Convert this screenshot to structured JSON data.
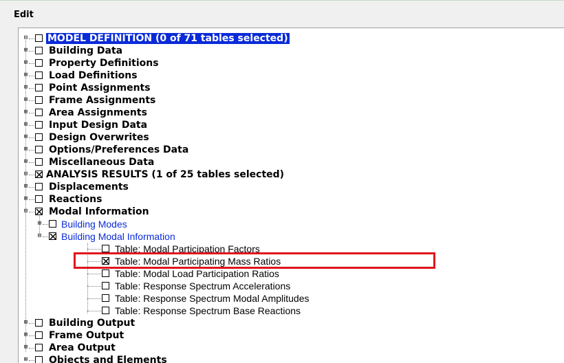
{
  "menu": {
    "edit": "Edit"
  },
  "tree": {
    "model_definition": {
      "label": "MODEL DEFINITION  (0 of 71 tables selected)",
      "children": [
        "Building Data",
        "Property Definitions",
        "Load Definitions",
        "Point Assignments",
        "Frame Assignments",
        "Area Assignments",
        "Input Design Data",
        "Design Overwrites",
        "Options/Preferences Data",
        "Miscellaneous Data"
      ]
    },
    "analysis_results": {
      "label": "ANALYSIS RESULTS  (1 of 25 tables selected)",
      "displacements": "Displacements",
      "reactions": "Reactions",
      "modal_information": "Modal Information",
      "building_modes": "Building Modes",
      "building_modal_information": "Building Modal Information",
      "tables": [
        "Table:  Modal Participation Factors",
        "Table:  Modal Participating Mass Ratios",
        "Table:  Modal Load Participation Ratios",
        "Table:  Response Spectrum Accelerations",
        "Table:  Response Spectrum Modal Amplitudes",
        "Table:  Response Spectrum Base Reactions"
      ],
      "building_output": "Building Output",
      "frame_output": "Frame Output",
      "area_output": "Area Output",
      "objects_and_elements": "Objects and Elements"
    }
  },
  "colors": {
    "selection": "#0a2bd8",
    "highlight": "#e0141c",
    "link_blue": "#0a2bd8"
  }
}
